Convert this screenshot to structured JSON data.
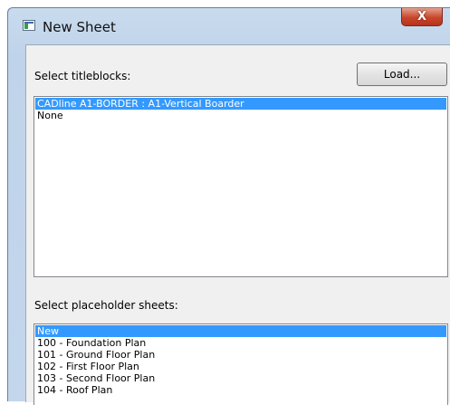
{
  "window": {
    "title": "New Sheet",
    "close_label": "X"
  },
  "titleblocks": {
    "label": "Select titleblocks:",
    "load_button": "Load...",
    "items": [
      {
        "label": "CADline A1-BORDER : A1-Vertical Boarder",
        "selected": true
      },
      {
        "label": "None",
        "selected": false
      }
    ]
  },
  "placeholders": {
    "label": "Select placeholder sheets:",
    "items": [
      {
        "label": "New",
        "selected": true
      },
      {
        "label": "100 - Foundation Plan",
        "selected": false
      },
      {
        "label": "101 - Ground Floor Plan",
        "selected": false
      },
      {
        "label": "102 - First Floor Plan",
        "selected": false
      },
      {
        "label": "103 - Second Floor Plan",
        "selected": false
      },
      {
        "label": "104 - Roof Plan",
        "selected": false
      }
    ]
  },
  "colors": {
    "selection": "#3399ff",
    "window_frame": "#c3d6ec",
    "close_button": "#c7462c"
  }
}
